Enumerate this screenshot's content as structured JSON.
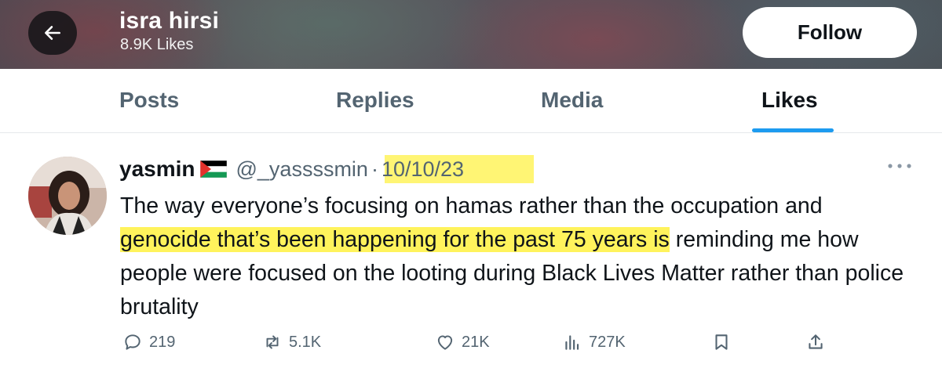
{
  "header": {
    "profile_name": "isra hirsi",
    "likes_count": "8.9K Likes",
    "follow_label": "Follow"
  },
  "tabs": [
    {
      "label": "Posts",
      "active": false
    },
    {
      "label": "Replies",
      "active": false
    },
    {
      "label": "Media",
      "active": false
    },
    {
      "label": "Likes",
      "active": true
    }
  ],
  "post": {
    "author_name": "yasmin",
    "handle": "@_yassssmin",
    "separator": "·",
    "date": "10/10/23",
    "text_part1": "The way everyone’s focusing on hamas rather than the occupation and ",
    "text_highlight": "genocide that’s been happening for the past 75 years is",
    "text_part2": " reminding me how people were focused on the looting during Black Lives Matter rather than police brutality",
    "replies": "219",
    "reposts": "5.1K",
    "likes": "21K",
    "views": "727K"
  },
  "colors": {
    "accent": "#1d9bf0",
    "highlight": "#fff35c",
    "muted_text": "#536471"
  },
  "icons": [
    "back-arrow-icon",
    "palestine-flag-icon",
    "more-options-icon",
    "reply-icon",
    "repost-icon",
    "like-icon",
    "views-icon",
    "bookmark-icon",
    "share-icon"
  ]
}
